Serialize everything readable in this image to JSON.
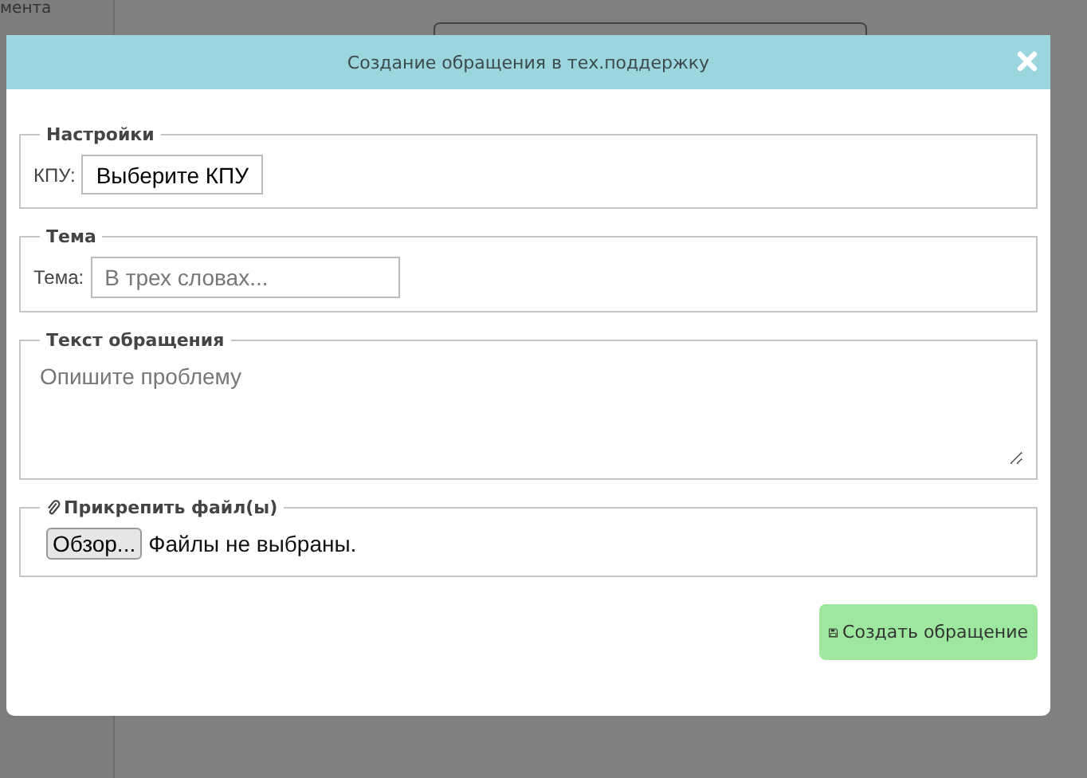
{
  "background": {
    "sidebar_text": "мента"
  },
  "dialog": {
    "title": "Создание обращения в тех.поддержку",
    "sections": [
      {
        "kind": "select",
        "legend": "Настройки",
        "label": "КПУ:",
        "value": "Выберите КПУ"
      },
      {
        "kind": "text",
        "legend": "Тема",
        "label": "Тема:",
        "placeholder": "В трех словах..."
      },
      {
        "kind": "textarea",
        "legend": "Текст обращения",
        "placeholder": "Опишите проблему"
      },
      {
        "kind": "file",
        "legend": "Прикрепить файл(ы)",
        "button": "Обзор...",
        "status": "Файлы не выбраны."
      }
    ],
    "submit": "Создать обращение"
  }
}
